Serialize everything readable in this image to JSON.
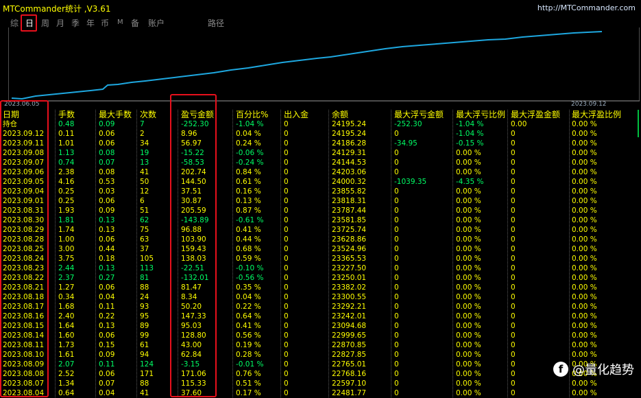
{
  "app": {
    "title": "MTCommander统计 ,V3.61",
    "url": "http://MTCommander.com"
  },
  "tabs": [
    "综",
    "日",
    "周",
    "月",
    "季",
    "年",
    "币",
    "M",
    "备",
    "账户",
    "路径"
  ],
  "selected_tab": "日",
  "equity_chart": {
    "start_date": "2023.06.05",
    "end_date": "2023.09.12",
    "line_color": "#1ea8e0"
  },
  "table": {
    "headers": [
      "日期",
      "手数",
      "最大手数",
      "次数",
      "盈亏金额",
      "百分比%",
      "出入金",
      "余额",
      "最大浮亏金额",
      "最大浮亏比例",
      "最大浮盈金额",
      "最大浮盈比例"
    ],
    "rows": [
      [
        "持仓",
        "0.48",
        "0.09",
        "7",
        "-252.30",
        "-1.04 %",
        "0",
        "24195.24",
        "-252.30",
        "-1.04 %",
        "0.00",
        "0.00 %"
      ],
      [
        "2023.09.12",
        "0.11",
        "0.06",
        "2",
        "8.96",
        "0.04 %",
        "0",
        "24195.24",
        "0",
        "-1.04 %",
        "0",
        "0.00 %"
      ],
      [
        "2023.09.11",
        "1.01",
        "0.06",
        "34",
        "56.97",
        "0.24 %",
        "0",
        "24186.28",
        "-34.95",
        "-0.15 %",
        "0",
        "0.00 %"
      ],
      [
        "2023.09.08",
        "1.13",
        "0.08",
        "19",
        "-15.22",
        "-0.06 %",
        "0",
        "24129.31",
        "0",
        "0.00 %",
        "0",
        "0.00 %"
      ],
      [
        "2023.09.07",
        "0.74",
        "0.07",
        "13",
        "-58.53",
        "-0.24 %",
        "0",
        "24144.53",
        "0",
        "0.00 %",
        "0",
        "0.00 %"
      ],
      [
        "2023.09.06",
        "2.38",
        "0.08",
        "41",
        "202.74",
        "0.84 %",
        "0",
        "24203.06",
        "0",
        "0.00 %",
        "0",
        "0.00 %"
      ],
      [
        "2023.09.05",
        "4.16",
        "0.53",
        "50",
        "144.50",
        "0.61 %",
        "0",
        "24000.32",
        "-1039.35",
        "-4.35 %",
        "0",
        "0.00 %"
      ],
      [
        "2023.09.04",
        "0.25",
        "0.03",
        "12",
        "37.51",
        "0.16 %",
        "0",
        "23855.82",
        "0",
        "0.00 %",
        "0",
        "0.00 %"
      ],
      [
        "2023.09.01",
        "0.25",
        "0.06",
        "6",
        "30.87",
        "0.13 %",
        "0",
        "23818.31",
        "0",
        "0.00 %",
        "0",
        "0.00 %"
      ],
      [
        "2023.08.31",
        "1.93",
        "0.09",
        "51",
        "205.59",
        "0.87 %",
        "0",
        "23787.44",
        "0",
        "0.00 %",
        "0",
        "0.00 %"
      ],
      [
        "2023.08.30",
        "1.81",
        "0.13",
        "62",
        "-143.89",
        "-0.61 %",
        "0",
        "23581.85",
        "0",
        "0.00 %",
        "0",
        "0.00 %"
      ],
      [
        "2023.08.29",
        "1.74",
        "0.13",
        "75",
        "96.88",
        "0.41 %",
        "0",
        "23725.74",
        "0",
        "0.00 %",
        "0",
        "0.00 %"
      ],
      [
        "2023.08.28",
        "1.00",
        "0.06",
        "63",
        "103.90",
        "0.44 %",
        "0",
        "23628.86",
        "0",
        "0.00 %",
        "0",
        "0.00 %"
      ],
      [
        "2023.08.25",
        "3.00",
        "0.44",
        "37",
        "159.43",
        "0.68 %",
        "0",
        "23524.96",
        "0",
        "0.00 %",
        "0",
        "0.00 %"
      ],
      [
        "2023.08.24",
        "3.75",
        "0.18",
        "105",
        "138.03",
        "0.59 %",
        "0",
        "23365.53",
        "0",
        "0.00 %",
        "0",
        "0.00 %"
      ],
      [
        "2023.08.23",
        "2.44",
        "0.13",
        "113",
        "-22.51",
        "-0.10 %",
        "0",
        "23227.50",
        "0",
        "0.00 %",
        "0",
        "0.00 %"
      ],
      [
        "2023.08.22",
        "2.37",
        "0.27",
        "81",
        "-132.01",
        "-0.56 %",
        "0",
        "23250.01",
        "0",
        "0.00 %",
        "0",
        "0.00 %"
      ],
      [
        "2023.08.21",
        "1.27",
        "0.06",
        "88",
        "81.47",
        "0.35 %",
        "0",
        "23382.02",
        "0",
        "0.00 %",
        "0",
        "0.00 %"
      ],
      [
        "2023.08.18",
        "0.34",
        "0.04",
        "24",
        "8.34",
        "0.04 %",
        "0",
        "23300.55",
        "0",
        "0.00 %",
        "0",
        "0.00 %"
      ],
      [
        "2023.08.17",
        "1.68",
        "0.11",
        "93",
        "50.20",
        "0.22 %",
        "0",
        "23292.21",
        "0",
        "0.00 %",
        "0",
        "0.00 %"
      ],
      [
        "2023.08.16",
        "2.40",
        "0.22",
        "95",
        "147.33",
        "0.64 %",
        "0",
        "23242.01",
        "0",
        "0.00 %",
        "0",
        "0.00 %"
      ],
      [
        "2023.08.15",
        "1.64",
        "0.13",
        "89",
        "95.03",
        "0.41 %",
        "0",
        "23094.68",
        "0",
        "0.00 %",
        "0",
        "0.00 %"
      ],
      [
        "2023.08.14",
        "1.60",
        "0.06",
        "99",
        "128.80",
        "0.56 %",
        "0",
        "22999.65",
        "0",
        "0.00 %",
        "0",
        "0.00 %"
      ],
      [
        "2023.08.11",
        "1.73",
        "0.15",
        "61",
        "43.00",
        "0.19 %",
        "0",
        "22870.85",
        "0",
        "0.00 %",
        "0",
        "0.00 %"
      ],
      [
        "2023.08.10",
        "1.61",
        "0.09",
        "94",
        "62.84",
        "0.28 %",
        "0",
        "22827.85",
        "0",
        "0.00 %",
        "0",
        "0.00 %"
      ],
      [
        "2023.08.09",
        "2.07",
        "0.11",
        "124",
        "-3.15",
        "-0.01 %",
        "0",
        "22765.01",
        "0",
        "0.00 %",
        "0",
        "0.00 %"
      ],
      [
        "2023.08.08",
        "2.52",
        "0.06",
        "171",
        "171.06",
        "0.76 %",
        "0",
        "22768.16",
        "0",
        "0.00 %",
        "0",
        "0.00 %"
      ],
      [
        "2023.08.07",
        "1.34",
        "0.07",
        "88",
        "115.33",
        "0.51 %",
        "0",
        "22597.10",
        "0",
        "0.00 %",
        "0",
        "0.00 %"
      ],
      [
        "2023.08.04",
        "0.64",
        "0.04",
        "41",
        "37.60",
        "0.17 %",
        "0",
        "22481.77",
        "0",
        "0.00 %",
        "0",
        "0.00 %"
      ]
    ],
    "row_color": {
      "positive": "#ffff00",
      "negative": "#00ff66"
    }
  },
  "watermark": {
    "icon": "f",
    "text": "@量化趋势"
  }
}
